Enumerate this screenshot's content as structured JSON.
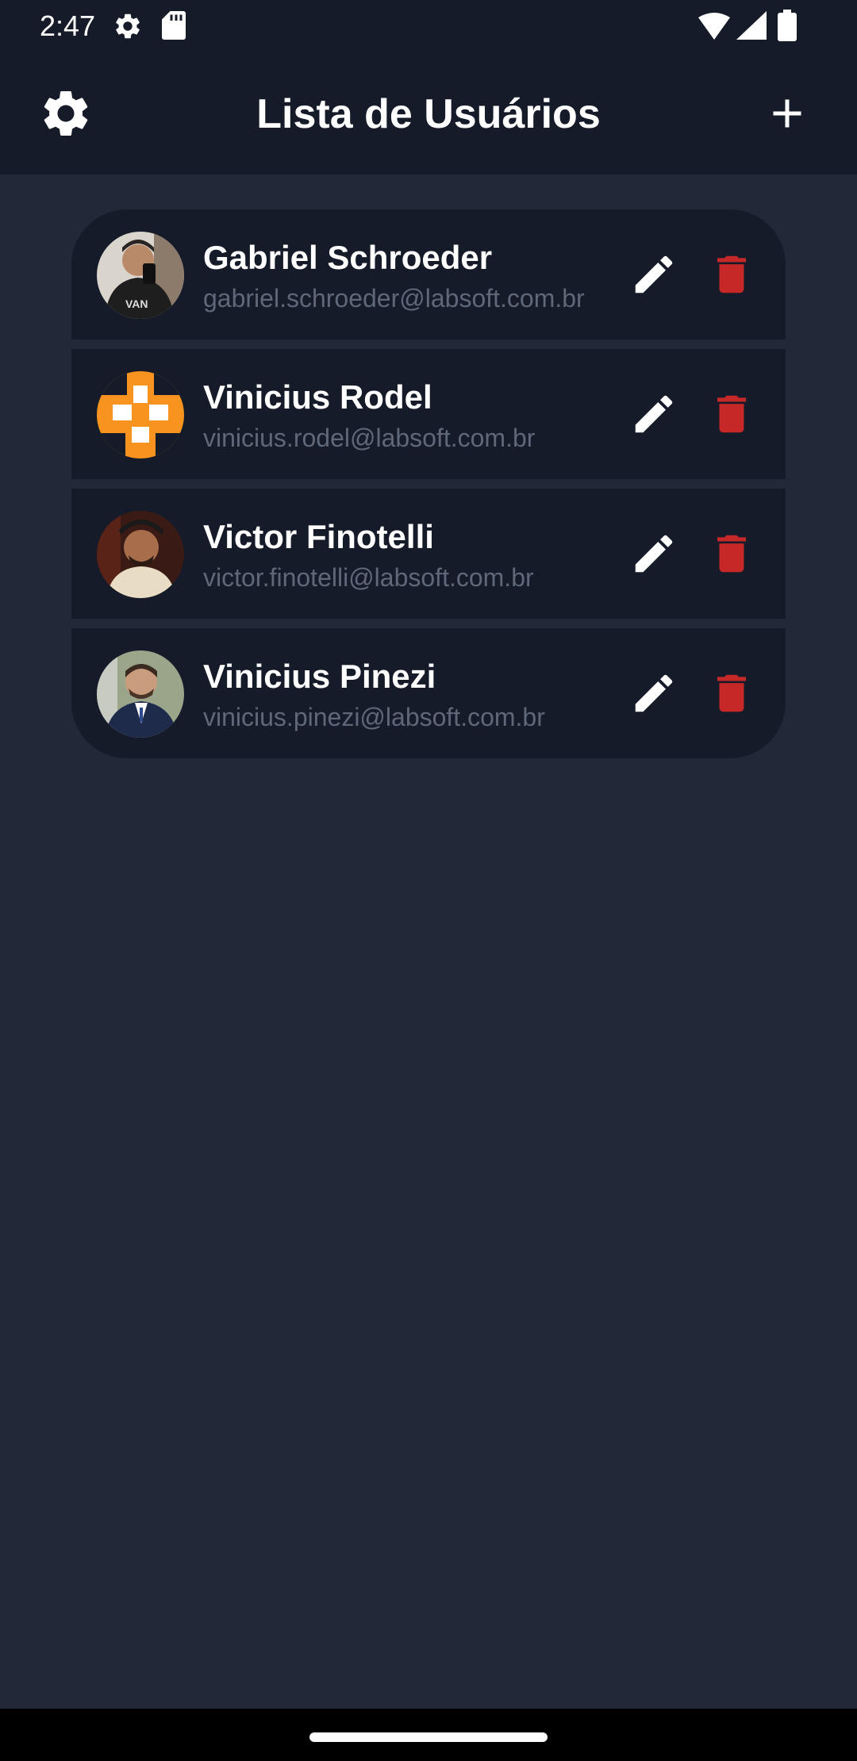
{
  "status_bar": {
    "time": "2:47",
    "icons": [
      "settings-gear-icon",
      "sd-card-icon",
      "wifi-icon",
      "signal-icon",
      "battery-icon"
    ]
  },
  "app_bar": {
    "title": "Lista de Usuários",
    "left_icon": "settings-icon",
    "right_icon": "add-icon"
  },
  "users": [
    {
      "name": "Gabriel Schroeder",
      "email": "gabriel.schroeder@labsoft.com.br",
      "edit_icon": "edit-icon",
      "delete_icon": "delete-icon"
    },
    {
      "name": "Vinicius Rodel",
      "email": "vinicius.rodel@labsoft.com.br",
      "edit_icon": "edit-icon",
      "delete_icon": "delete-icon"
    },
    {
      "name": "Victor Finotelli",
      "email": "victor.finotelli@labsoft.com.br",
      "edit_icon": "edit-icon",
      "delete_icon": "delete-icon"
    },
    {
      "name": "Vinicius Pinezi",
      "email": "vinicius.pinezi@labsoft.com.br",
      "edit_icon": "edit-icon",
      "delete_icon": "delete-icon"
    }
  ],
  "colors": {
    "background": "#212837",
    "bar": "#151b29",
    "card": "#151b29",
    "text": "#ffffff",
    "subtext": "#5f6878",
    "delete": "#c62828"
  }
}
